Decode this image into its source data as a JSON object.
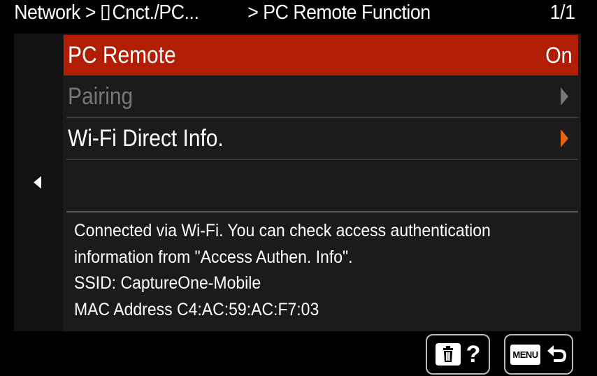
{
  "header": {
    "breadcrumb_first": "Network >",
    "breadcrumb_second": "Cnct./PC...",
    "breadcrumb_third": "> PC Remote Function",
    "page_indicator": "1/1"
  },
  "menu": {
    "items": [
      {
        "label": "PC Remote",
        "value": "On",
        "selected": true,
        "enabled": true
      },
      {
        "label": "Pairing",
        "value": "",
        "selected": false,
        "enabled": false
      },
      {
        "label": "Wi-Fi Direct Info.",
        "value": "",
        "selected": false,
        "enabled": true
      }
    ]
  },
  "info": {
    "line1": "Connected via Wi-Fi. You can check access authentication",
    "line2": "information from \"Access Authen. Info\".",
    "line3": "SSID: CaptureOne-Mobile",
    "line4": "MAC Address  C4:AC:59:AC:F7:03"
  },
  "footer": {
    "help_label": "?",
    "menu_label": "MENU"
  },
  "icons": {
    "back_nav": "left-triangle-icon",
    "submenu": "right-triangle-icon",
    "help": "trash-icon",
    "return": "return-arrow-icon"
  },
  "colors": {
    "selected_row": "#b01e06",
    "submenu_arrow_active": "#e8650a",
    "disabled_text": "#777777"
  }
}
